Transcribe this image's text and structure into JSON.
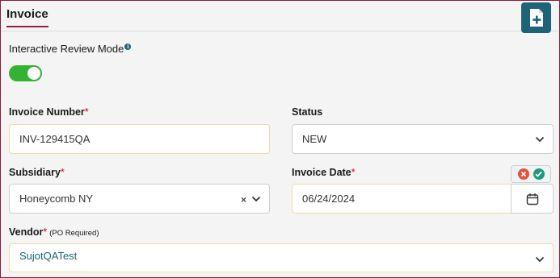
{
  "tab": {
    "label": "Invoice"
  },
  "toolbar": {
    "add_icon": "add-document-icon"
  },
  "review_mode": {
    "label": "Interactive Review Mode",
    "info": "i",
    "enabled": true
  },
  "fields": {
    "invoice_number": {
      "label": "Invoice Number",
      "required": "*",
      "value": "INV-129415QA"
    },
    "status": {
      "label": "Status",
      "value": "NEW"
    },
    "subsidiary": {
      "label": "Subsidiary",
      "required": "*",
      "value": "Honeycomb NY",
      "clear": "×"
    },
    "invoice_date": {
      "label": "Invoice Date",
      "required": "*",
      "value": "06/24/2024"
    },
    "vendor": {
      "label": "Vendor",
      "required": "*",
      "note": "(PO Required)",
      "value": "SujotQATest"
    }
  },
  "colors": {
    "accent": "#9b1b40",
    "brand": "#1c6476",
    "toggle_on": "#34b233",
    "reject": "#e5533c",
    "accept": "#1f9a7a"
  }
}
